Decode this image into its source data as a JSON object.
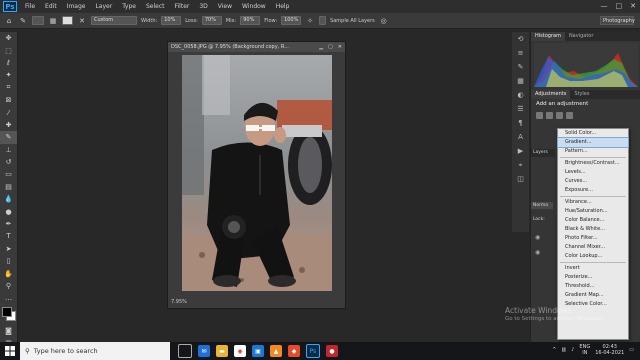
{
  "app": {
    "logo": "Ps"
  },
  "menu": [
    "File",
    "Edit",
    "Image",
    "Layer",
    "Type",
    "Select",
    "Filter",
    "3D",
    "View",
    "Window",
    "Help"
  ],
  "window_controls": [
    "—",
    "□",
    "✕"
  ],
  "options": {
    "feather_label": "Custom",
    "width_label": "Width:",
    "width_value": "10%",
    "loss_label": "Loss:",
    "loss_value": "70%",
    "mix_label": "Mix:",
    "mix_value": "90%",
    "flow_label": "Flow:",
    "flow_value": "100%",
    "sample_label": "Sample All Layers",
    "workspace": "Photography"
  },
  "document": {
    "title": "DSC_0058.JPG @ 7.95% (Background copy, R...",
    "zoom": "7.95%"
  },
  "panels": {
    "histogram_tab": "Histogram",
    "navigator_tab": "Navigator",
    "adjustments_tab": "Adjustments",
    "styles_tab": "Styles",
    "add_adjustment": "Add an adjustment",
    "layers_tabs": [
      "Layers",
      "Norma",
      "Lock:"
    ]
  },
  "adjustment_menu": {
    "groups": [
      [
        "Solid Color...",
        "Gradient...",
        "Pattern..."
      ],
      [
        "Brightness/Contrast...",
        "Levels...",
        "Curves...",
        "Exposure..."
      ],
      [
        "Vibrance...",
        "Hue/Saturation...",
        "Color Balance...",
        "Black & White...",
        "Photo Filter...",
        "Channel Mixer...",
        "Color Lookup..."
      ],
      [
        "Invert",
        "Posterize...",
        "Threshold...",
        "Gradient Map...",
        "Selective Color..."
      ]
    ],
    "highlighted": "Gradient..."
  },
  "watermark": {
    "line1": "Activate Windows",
    "line2": "Go to Settings to activate Windows."
  },
  "taskbar": {
    "search_placeholder": "Type here to search",
    "lang1": "ENG",
    "lang2": "IN",
    "time": "02:43",
    "date": "16-04-2021"
  }
}
